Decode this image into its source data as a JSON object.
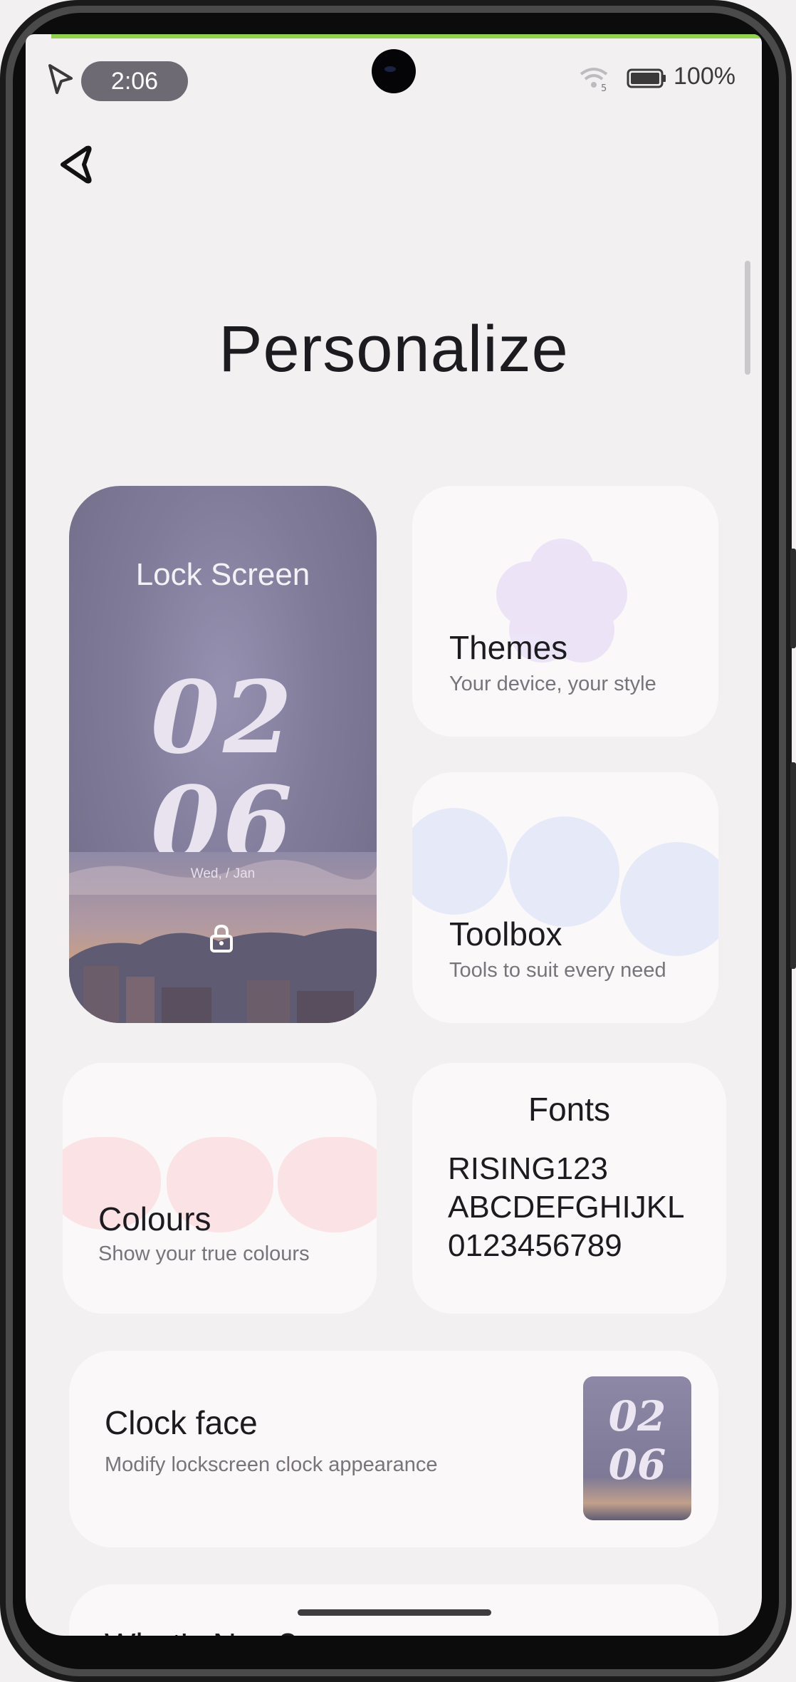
{
  "status_bar": {
    "time": "2:06",
    "wifi_badge": "5",
    "battery": "100%",
    "icons": [
      "cursor-icon",
      "wifi-icon",
      "battery-icon"
    ]
  },
  "nav": {
    "back_icon": "back-arrow-icon"
  },
  "page": {
    "title": "Personalize"
  },
  "lock_screen": {
    "title": "Lock Screen",
    "clock_hours": "02",
    "clock_minutes": "06",
    "date": "Wed, / Jan",
    "icon": "lock-icon"
  },
  "cards": {
    "themes": {
      "title": "Themes",
      "subtitle": "Your device, your style"
    },
    "toolbox": {
      "title": "Toolbox",
      "subtitle": "Tools to suit every need"
    },
    "colours": {
      "title": "Colours",
      "subtitle": "Show your true colours"
    },
    "fonts": {
      "title": "Fonts",
      "sample_lines": [
        "RISING123",
        "ABCDEFGHIJKL",
        "0123456789"
      ]
    },
    "clock_face": {
      "title": "Clock face",
      "subtitle": "Modify lockscreen clock appearance",
      "preview_hours": "02",
      "preview_minutes": "06"
    },
    "whats_new": {
      "title": "What's New?"
    }
  },
  "colors": {
    "background": "#f2f0f1",
    "card": "#fbf8f9",
    "accent_green": "#8fd34a",
    "lock_purple": "#7f7b99",
    "themes_petal": "#ece4f7",
    "toolbox_blue": "#e6e9f8",
    "colours_pink": "#fbe3e5"
  }
}
